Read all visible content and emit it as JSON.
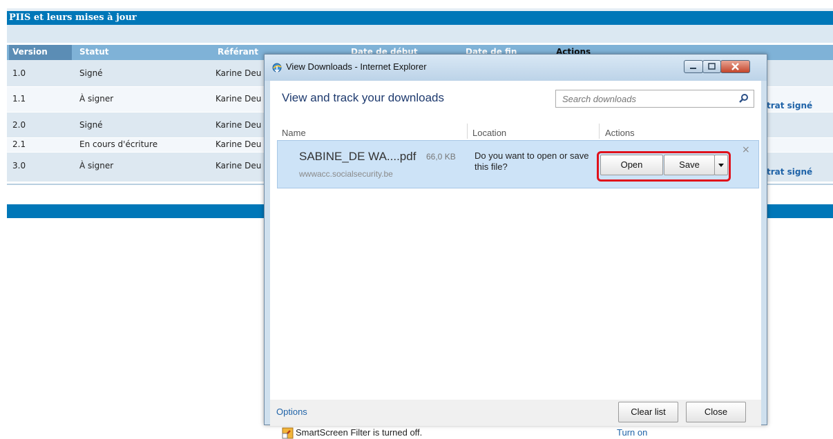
{
  "background": {
    "section_title": "PIIS et leurs mises à jour",
    "columns": [
      "Version",
      "Statut",
      "Référant",
      "Date de début",
      "Date de fin",
      "Actions"
    ],
    "rows": [
      {
        "version": "1.0",
        "statut": "Signé",
        "referant": "Karine Deu",
        "action": ""
      },
      {
        "version": "1.1",
        "statut": "À signer",
        "referant": "Karine Deu",
        "action": "trat signé"
      },
      {
        "version": "2.0",
        "statut": "Signé",
        "referant": "Karine Deu",
        "action": ""
      },
      {
        "version": "2.1",
        "statut": "En cours d'écriture",
        "referant": "Karine Deu",
        "action": ""
      },
      {
        "version": "3.0",
        "statut": "À signer",
        "referant": "Karine Deu",
        "action": "trat signé"
      }
    ]
  },
  "dialog": {
    "title": "View Downloads - Internet Explorer",
    "heading": "View and track your downloads",
    "search_placeholder": "Search downloads",
    "columns": {
      "name": "Name",
      "location": "Location",
      "actions": "Actions"
    },
    "download": {
      "filename": "SABINE_DE WA....pdf",
      "size": "66,0 KB",
      "source": "wwwacc.socialsecurity.be",
      "question": "Do you want to open or save this file?",
      "open_label": "Open",
      "save_label": "Save",
      "dropdown_label": "▾",
      "dismiss_label": "×"
    },
    "smartscreen_text": "SmartScreen Filter is turned off.",
    "turn_on_label": "Turn on",
    "options_label": "Options",
    "clear_list_label": "Clear list",
    "close_label": "Close"
  },
  "colors": {
    "highlight": "#e0111b",
    "header_blue": "#0077b8",
    "link_blue": "#1f63a8"
  }
}
